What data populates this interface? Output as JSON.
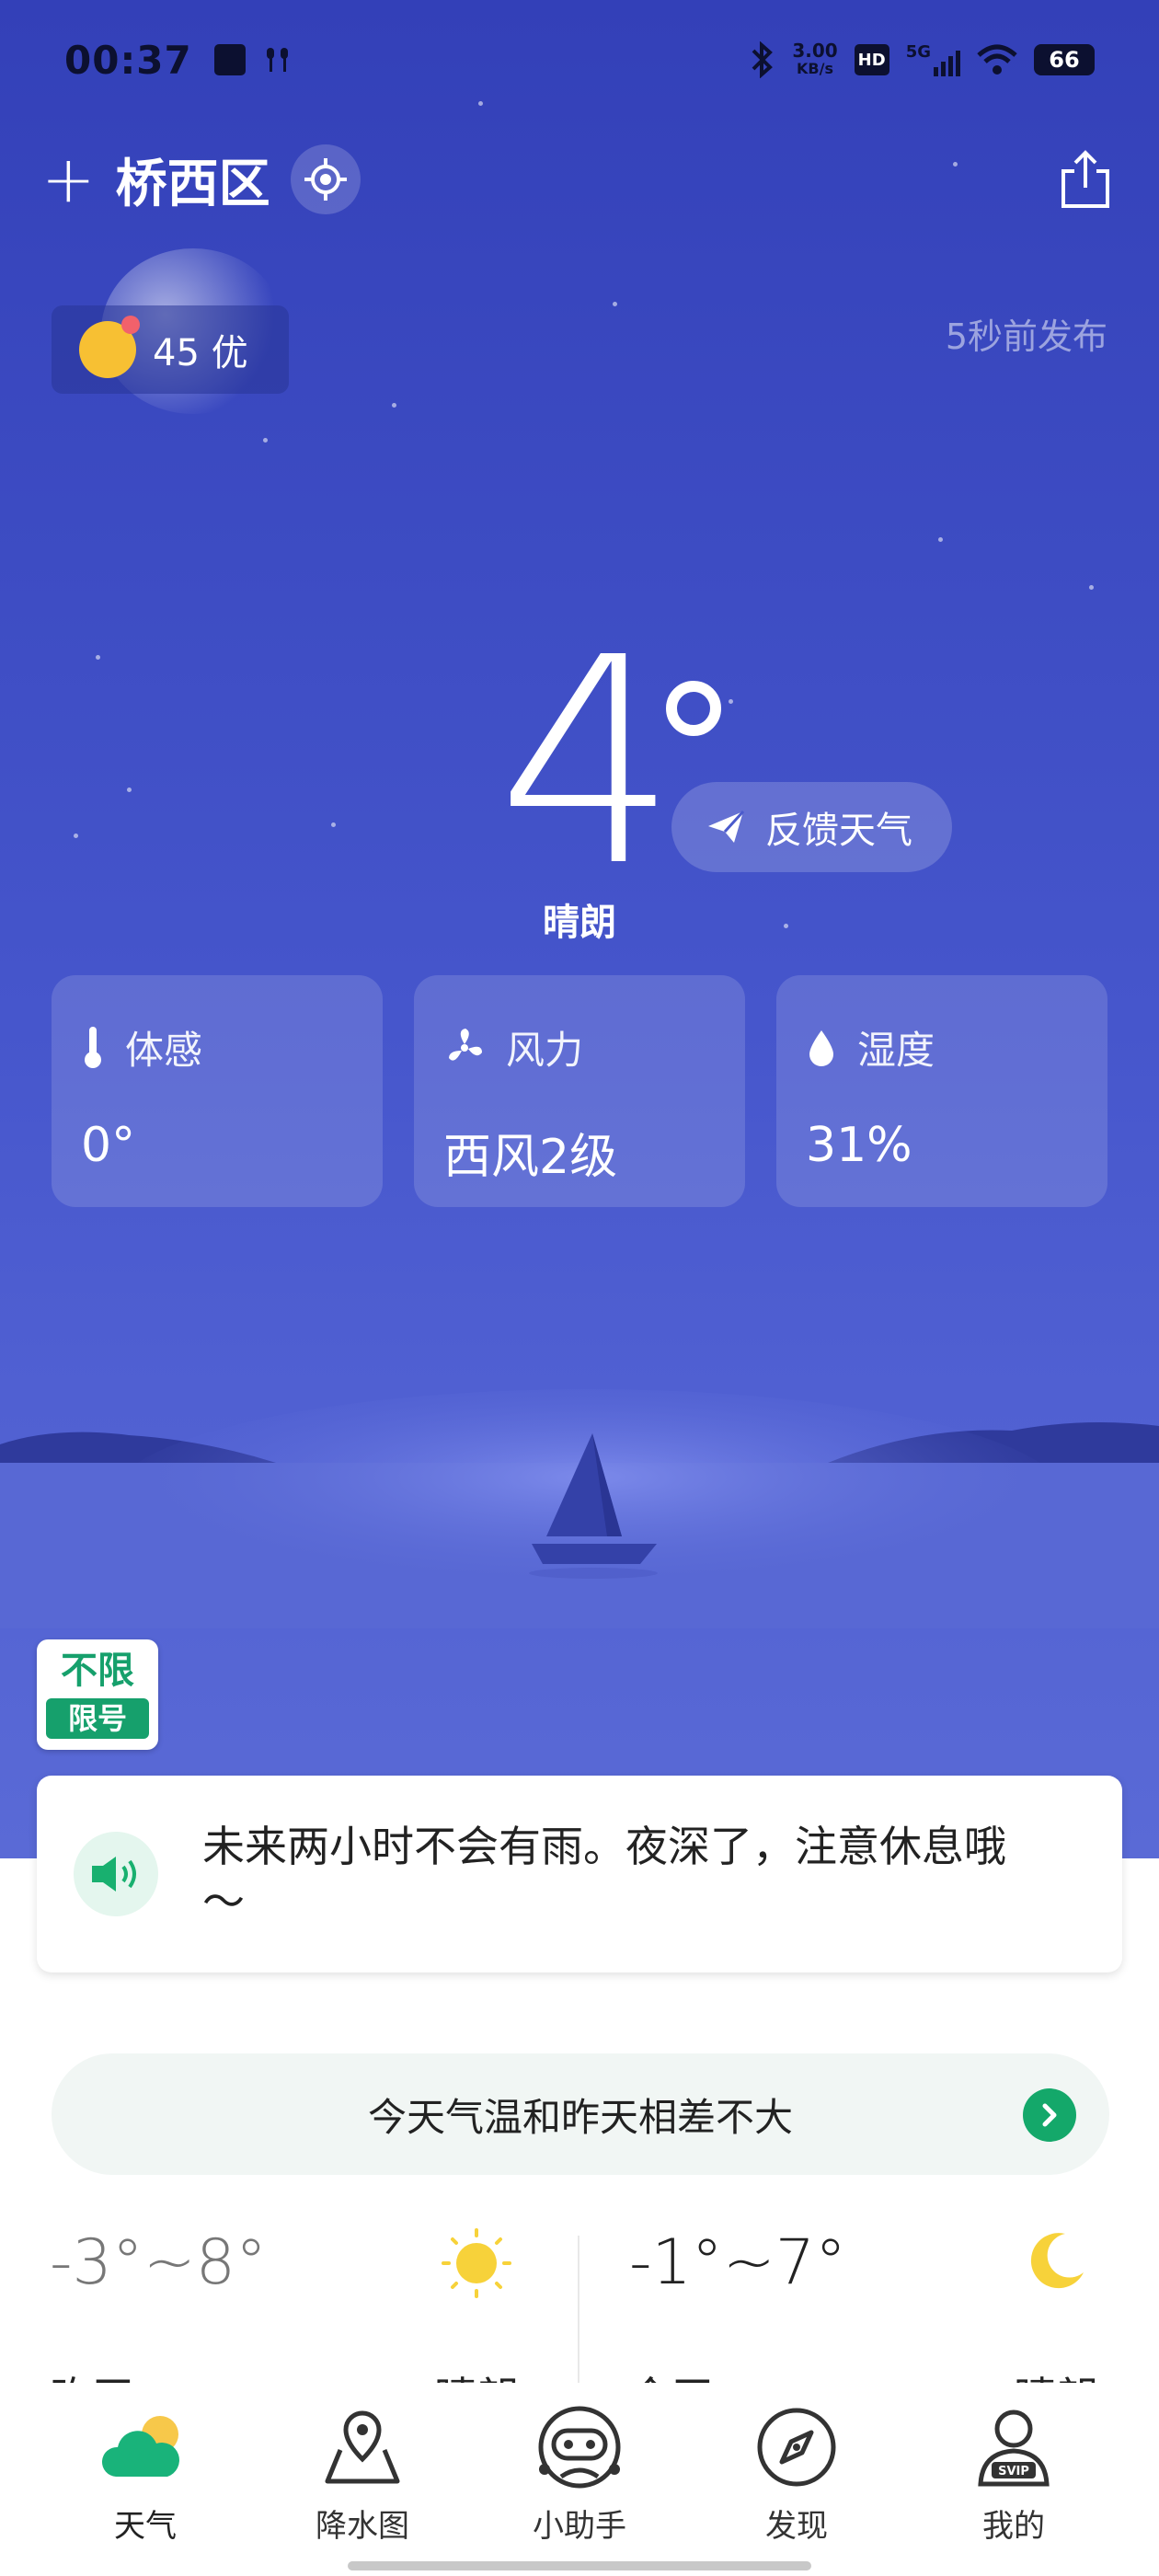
{
  "status_bar": {
    "time": "00:37",
    "net_speed": "3.00",
    "net_unit": "KB/s",
    "hd": "HD",
    "signal": "5G",
    "battery": "66"
  },
  "header": {
    "city": "桥西区",
    "add_icon": "plus-icon",
    "locate_icon": "locate-icon",
    "share_icon": "share-icon"
  },
  "aqi": {
    "value": "45",
    "level": "优",
    "text": "45 优"
  },
  "publish_time": "5秒前发布",
  "current": {
    "temperature": "4",
    "condition": "晴朗",
    "feedback_label": "反馈天气"
  },
  "cards": [
    {
      "icon": "thermometer-icon",
      "label": "体感",
      "value": "0°"
    },
    {
      "icon": "fan-icon",
      "label": "风力",
      "value": "西风2级"
    },
    {
      "icon": "droplet-icon",
      "label": "湿度",
      "value": "31%"
    }
  ],
  "restriction": {
    "top": "不限",
    "bottom": "限号"
  },
  "notice": {
    "text": "未来两小时不会有雨。夜深了，注意休息哦～"
  },
  "comparison": {
    "text": "今天气温和昨天相差不大"
  },
  "days": [
    {
      "temp_range": "-3°~8°",
      "day": "昨天",
      "condition": "晴朗",
      "icon": "sun-icon"
    },
    {
      "temp_range": "-1°~7°",
      "day": "今天",
      "condition": "晴朗",
      "icon": "moon-icon"
    }
  ],
  "tabs": [
    {
      "label": "天气",
      "icon": "weather-cloud-icon",
      "active": true
    },
    {
      "label": "降水图",
      "icon": "map-pin-icon",
      "active": false
    },
    {
      "label": "小助手",
      "icon": "assistant-robot-icon",
      "active": false
    },
    {
      "label": "发现",
      "icon": "compass-icon",
      "active": false
    },
    {
      "label": "我的",
      "icon": "svip-user-icon",
      "active": false
    }
  ],
  "colors": {
    "sky_top": "#3340b8",
    "sky_bottom": "#5a6ad6",
    "accent_green": "#14a86a",
    "sun_yellow": "#f7d23a"
  }
}
